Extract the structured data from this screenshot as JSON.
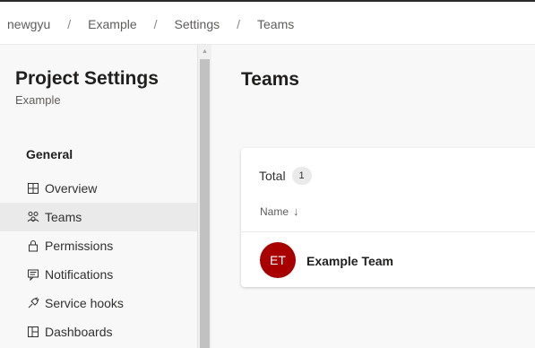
{
  "breadcrumb": {
    "items": [
      "newgyu",
      "Example",
      "Settings",
      "Teams"
    ],
    "separator": "/"
  },
  "sidebar": {
    "title": "Project Settings",
    "subtitle": "Example",
    "section": "General",
    "items": [
      {
        "label": "Overview",
        "icon": "overview-icon",
        "selected": false
      },
      {
        "label": "Teams",
        "icon": "teams-icon",
        "selected": true
      },
      {
        "label": "Permissions",
        "icon": "lock-icon",
        "selected": false
      },
      {
        "label": "Notifications",
        "icon": "notification-icon",
        "selected": false
      },
      {
        "label": "Service hooks",
        "icon": "service-hooks-icon",
        "selected": false
      },
      {
        "label": "Dashboards",
        "icon": "dashboards-icon",
        "selected": false
      }
    ]
  },
  "main": {
    "title": "Teams",
    "total_label": "Total",
    "total_count": "1",
    "column_name": "Name",
    "teams": [
      {
        "initials": "ET",
        "name": "Example Team",
        "avatar_color": "#a80000"
      }
    ]
  },
  "colors": {
    "selected_bg": "#eaeaea",
    "avatar": "#a80000"
  }
}
